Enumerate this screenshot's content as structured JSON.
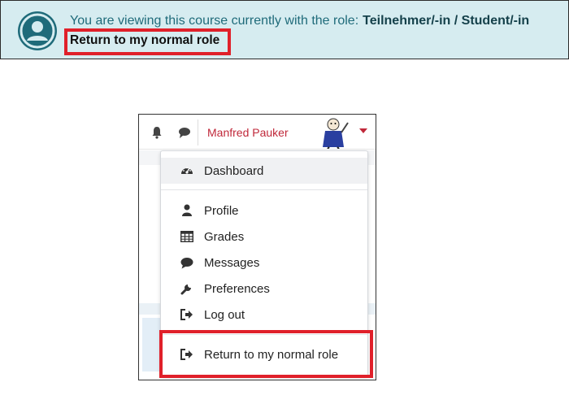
{
  "banner": {
    "message": "You are viewing this course currently with the role:",
    "role": "Teilnehmer/-in / Student/-in",
    "return_link": "Return to my normal role"
  },
  "navbar": {
    "icons": [
      "bell-icon",
      "chat-bubble-icon"
    ],
    "user_name": "Manfred Pauker"
  },
  "menu": {
    "items": [
      {
        "label": "Dashboard",
        "icon": "dashboard-gauge-icon"
      },
      {
        "label": "Profile",
        "icon": "user-icon"
      },
      {
        "label": "Grades",
        "icon": "table-icon"
      },
      {
        "label": "Messages",
        "icon": "chat-bubble-icon"
      },
      {
        "label": "Preferences",
        "icon": "wrench-icon"
      },
      {
        "label": "Log out",
        "icon": "sign-out-icon"
      },
      {
        "label": "Return to my normal role",
        "icon": "sign-out-icon"
      }
    ]
  },
  "colors": {
    "banner_bg": "#d6ecf0",
    "highlight": "#e0202a",
    "username": "#c0283a"
  }
}
